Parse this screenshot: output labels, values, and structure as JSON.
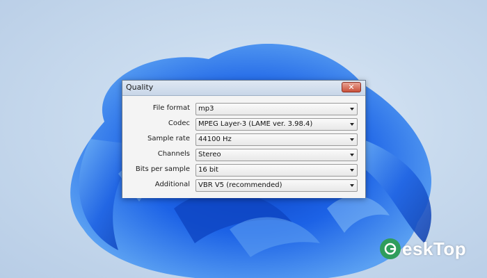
{
  "dialog": {
    "title": "Quality",
    "close_glyph": "✕",
    "fields": [
      {
        "label": "File format",
        "value": "mp3"
      },
      {
        "label": "Codec",
        "value": "MPEG Layer-3 (LAME ver. 3.98.4)"
      },
      {
        "label": "Sample rate",
        "value": "44100 Hz"
      },
      {
        "label": "Channels",
        "value": "Stereo"
      },
      {
        "label": "Bits per sample",
        "value": "16 bit"
      },
      {
        "label": "Additional",
        "value": "VBR V5 (recommended)"
      }
    ]
  },
  "watermark": {
    "text": "eskTop",
    "icon": "g-logo-icon"
  },
  "colors": {
    "accent_blue": "#1f5fe0",
    "close_red": "#c9503a",
    "watermark_green": "#2f9d5c"
  }
}
